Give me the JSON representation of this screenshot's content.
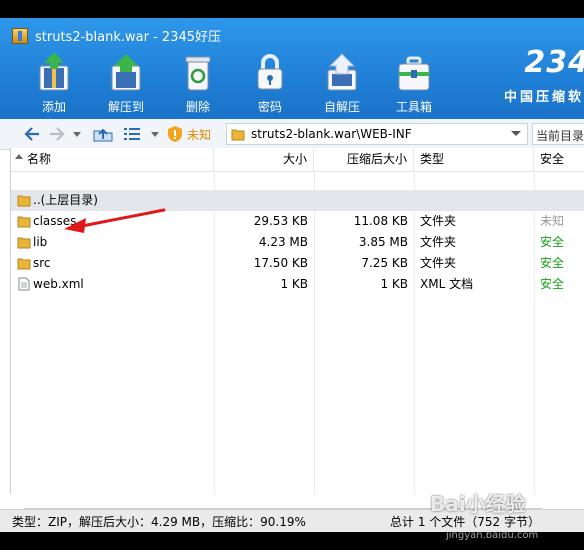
{
  "window": {
    "title": "struts2-blank.war - 2345好压"
  },
  "toolbar": {
    "items": [
      {
        "label": "添加",
        "icon": "add-icon"
      },
      {
        "label": "解压到",
        "icon": "extract-icon"
      },
      {
        "label": "删除",
        "icon": "delete-icon"
      },
      {
        "label": "密码",
        "icon": "lock-icon"
      },
      {
        "label": "自解压",
        "icon": "self-extract-icon"
      },
      {
        "label": "工具箱",
        "icon": "toolbox-icon"
      }
    ]
  },
  "brand": {
    "number": "234",
    "slogan": "中国压缩软"
  },
  "addressbar": {
    "security": "未知",
    "path": "struts2-blank.war\\WEB-INF",
    "search_placeholder": "当前目录"
  },
  "columns": [
    {
      "label": "名称"
    },
    {
      "label": "大小"
    },
    {
      "label": "压缩后大小"
    },
    {
      "label": "类型"
    },
    {
      "label": "安全"
    }
  ],
  "parent_row": {
    "name": "..(上层目录)"
  },
  "rows": [
    {
      "name": "classes",
      "size": "29.53 KB",
      "packed": "11.08 KB",
      "type": "文件夹",
      "security": "未知",
      "kind": "folder"
    },
    {
      "name": "lib",
      "size": "4.23 MB",
      "packed": "3.85 MB",
      "type": "文件夹",
      "security": "安全",
      "kind": "folder"
    },
    {
      "name": "src",
      "size": "17.50 KB",
      "packed": "7.25 KB",
      "type": "文件夹",
      "security": "安全",
      "kind": "folder"
    },
    {
      "name": "web.xml",
      "size": "1 KB",
      "packed": "1 KB",
      "type": "XML 文档",
      "security": "安全",
      "kind": "file"
    }
  ],
  "status": {
    "left": "类型：ZIP，解压后大小：4.29 MB，压缩比：90.19%",
    "right": "总计 1 个文件（752 字节）"
  },
  "watermark": {
    "main": "Bai小经验",
    "sub": "jingyan.baidu.com"
  },
  "colors": {
    "toolbar_blue": "#1f7fd6",
    "safe_green": "#19a019",
    "arrow_red": "#e01818",
    "folder_yellow": "#e8b53a"
  }
}
